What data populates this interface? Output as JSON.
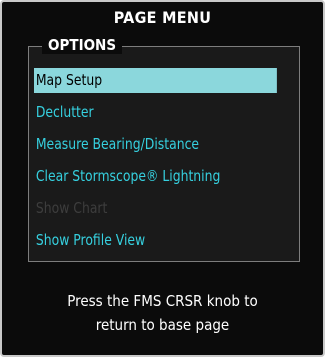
{
  "title": "PAGE MENU",
  "options_label": "OPTIONS",
  "menu_items": [
    {
      "label": "Map Setup",
      "state": "selected"
    },
    {
      "label": "Declutter",
      "state": "normal"
    },
    {
      "label": "Measure Bearing/Distance",
      "state": "normal"
    },
    {
      "label": "Clear Stormscope® Lightning",
      "state": "normal"
    },
    {
      "label": "Show Chart",
      "state": "disabled"
    },
    {
      "label": "Show Profile View",
      "state": "normal"
    }
  ],
  "help_line1": "Press the FMS CRSR knob to",
  "help_line2": "return to base page",
  "colors": {
    "background": "#0b0b0b",
    "item_text": "#36d0df",
    "selected_bg": "#8bd7dc",
    "disabled_text": "#3d3d3d"
  }
}
